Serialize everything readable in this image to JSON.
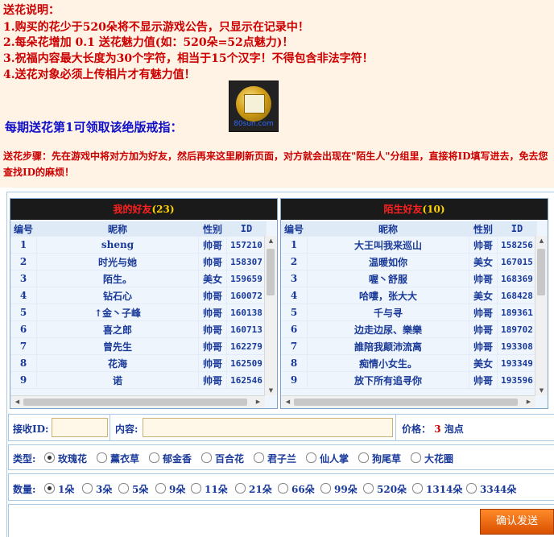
{
  "notice": {
    "title": "送花说明：",
    "rules": [
      "1.购买的花少于520朵将不显示游戏公告，只显示在记录中！",
      "2.每朵花增加 0.1 送花魅力值(如：520朵=52点魅力)！",
      "3.祝福内容最大长度为30个字符，相当于15个汉字！不得包含非法字符！",
      "4.送花对象必须上传相片才有魅力值！"
    ],
    "ring_text": "每期送花第1可领取该绝版戒指：",
    "ring_watermark": "80sun.com",
    "steps_label": "送花步骤：",
    "steps_text": "先在游戏中将对方加为好友，然后再来这里刷新页面，对方就会出现在\"陌生人\"分组里，直接将ID填写进去，免去您查找ID的麻烦！"
  },
  "friends": {
    "title": "我的好友",
    "count": "(23)",
    "headers": [
      "编号",
      "昵称",
      "性别",
      "ID"
    ],
    "rows": [
      [
        "1",
        "sheng",
        "帅哥",
        "157210"
      ],
      [
        "2",
        "时光与她",
        "帅哥",
        "158307"
      ],
      [
        "3",
        "陌生。",
        "美女",
        "159659"
      ],
      [
        "4",
        "钻石心",
        "帅哥",
        "160072"
      ],
      [
        "5",
        "↑金丶子峰",
        "帅哥",
        "160138"
      ],
      [
        "6",
        "喜之郎",
        "帅哥",
        "160713"
      ],
      [
        "7",
        "曾先生",
        "帅哥",
        "162279"
      ],
      [
        "8",
        "花海",
        "帅哥",
        "162509"
      ],
      [
        "9",
        "诺",
        "帅哥",
        "162546"
      ]
    ]
  },
  "strangers": {
    "title": "陌生好友",
    "count": "(10)",
    "headers": [
      "编号",
      "昵称",
      "性别",
      "ID"
    ],
    "rows": [
      [
        "1",
        "大王叫我来巡山",
        "帅哥",
        "158256"
      ],
      [
        "2",
        "温暖如你",
        "美女",
        "167015"
      ],
      [
        "3",
        "喔丶舒服",
        "帅哥",
        "168369"
      ],
      [
        "4",
        "哈嘍，张大大",
        "美女",
        "168428"
      ],
      [
        "5",
        "千与寻",
        "帅哥",
        "189361"
      ],
      [
        "6",
        "边走边尿、樂樂",
        "帅哥",
        "189702"
      ],
      [
        "7",
        "誰陪我颠沛流离",
        "帅哥",
        "193308"
      ],
      [
        "8",
        "痴情小女生。",
        "美女",
        "193349"
      ],
      [
        "9",
        "放下所有追寻你",
        "帅哥",
        "193596"
      ]
    ]
  },
  "form": {
    "receiver_label": "接收ID:",
    "receiver_value": "",
    "content_label": "内容:",
    "content_value": "",
    "price_label": "价格：",
    "price_value": "3",
    "price_unit": "泡点",
    "type_label": "类型:",
    "types": [
      "玫瑰花",
      "薰衣草",
      "郁金香",
      "百合花",
      "君子兰",
      "仙人掌",
      "狗尾草",
      "大花圈"
    ],
    "type_selected": 0,
    "qty_label": "数量:",
    "quantities": [
      "1朵",
      "3朵",
      "5朵",
      "9朵",
      "11朵",
      "21朵",
      "66朵",
      "99朵",
      "520朵",
      "1314朵",
      "3344朵"
    ],
    "qty_selected": 0,
    "submit_label": "确认发送"
  }
}
